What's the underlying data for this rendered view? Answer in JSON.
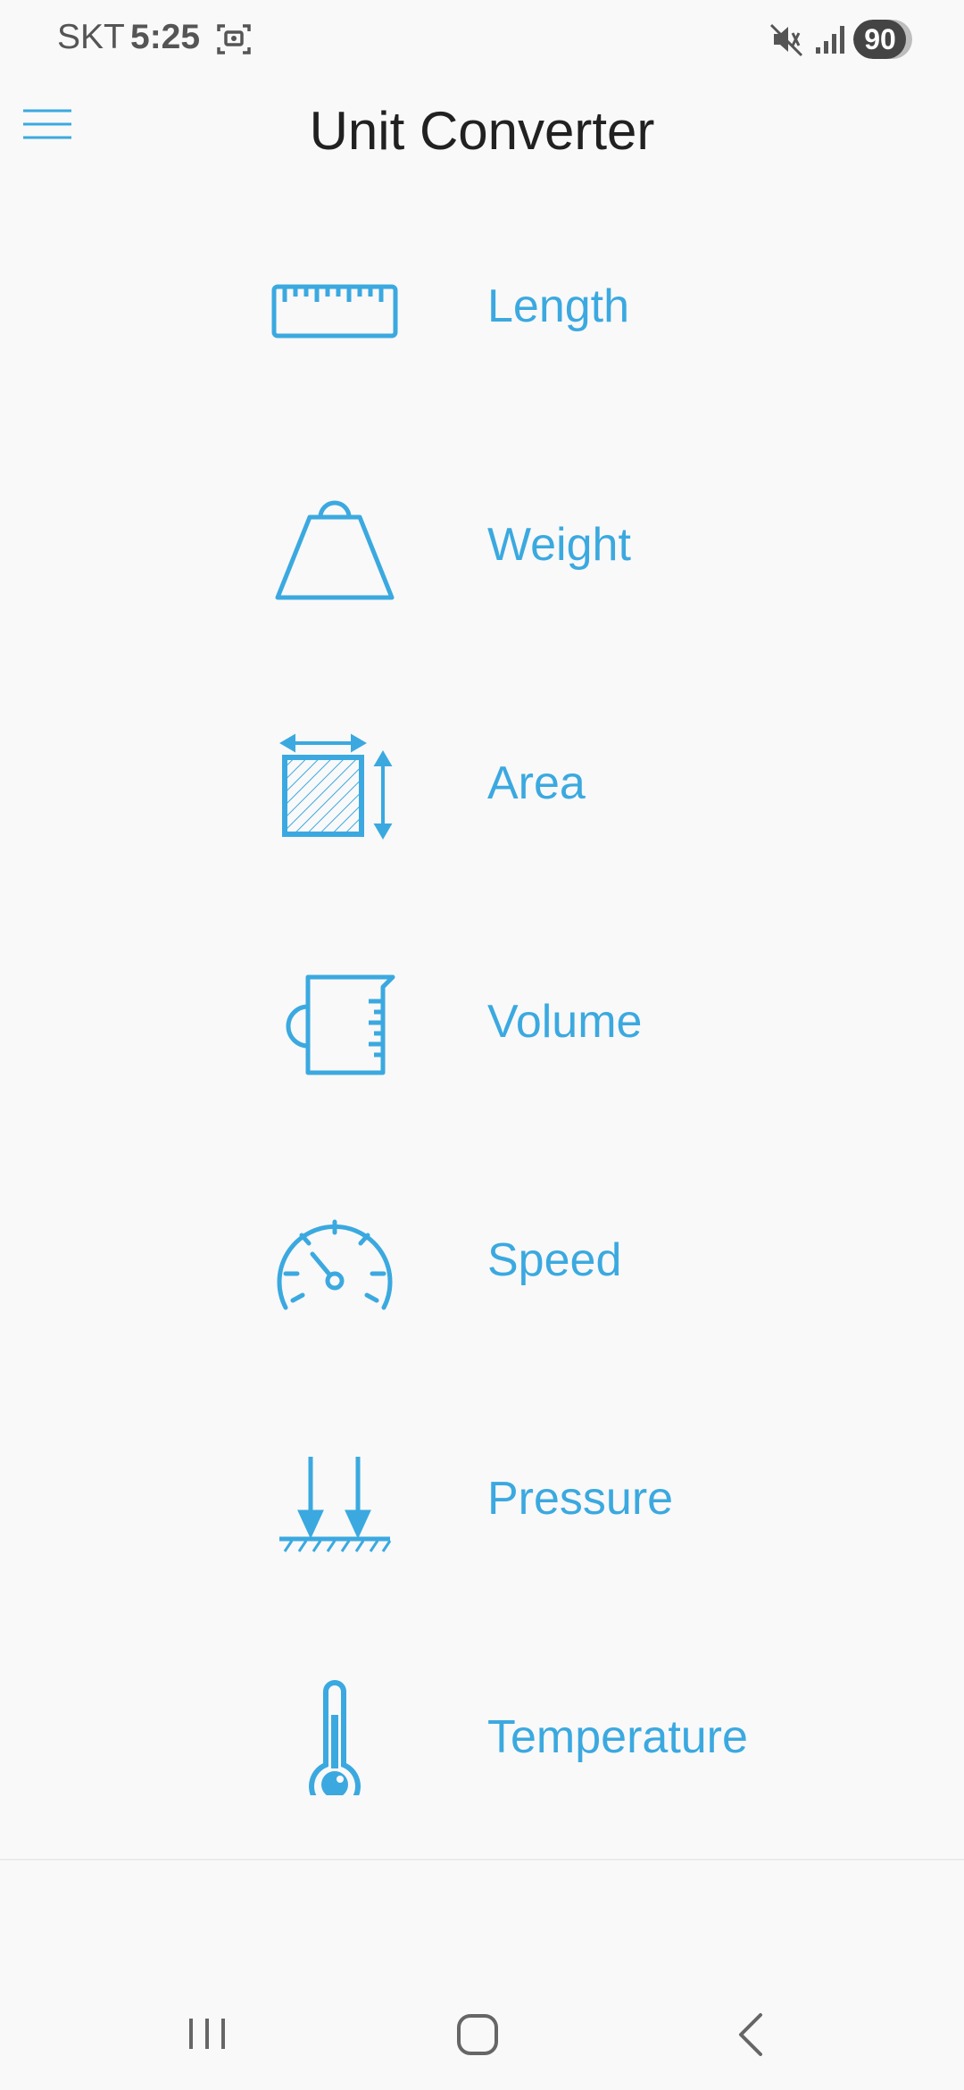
{
  "status_bar": {
    "carrier": "SKT",
    "time": "5:25",
    "battery_level": "90",
    "battery_fraction": 0.9,
    "icons": [
      "screenshot-icon",
      "mute-icon",
      "signal-icon",
      "battery-icon"
    ]
  },
  "app_bar": {
    "title": "Unit Converter",
    "menu_icon": "hamburger-menu-icon"
  },
  "units": [
    {
      "label": "Length",
      "icon": "ruler-icon"
    },
    {
      "label": "Weight",
      "icon": "weight-icon"
    },
    {
      "label": "Area",
      "icon": "area-icon"
    },
    {
      "label": "Volume",
      "icon": "measuring-cup-icon"
    },
    {
      "label": "Speed",
      "icon": "speedometer-icon"
    },
    {
      "label": "Pressure",
      "icon": "pressure-icon"
    },
    {
      "label": "Temperature",
      "icon": "thermometer-icon"
    }
  ],
  "nav_bar": {
    "icons": [
      "recent-apps-icon",
      "home-icon",
      "back-icon"
    ]
  },
  "colors": {
    "accent": "#3ba9e0",
    "title": "#212121",
    "background": "#f9f9f9"
  }
}
